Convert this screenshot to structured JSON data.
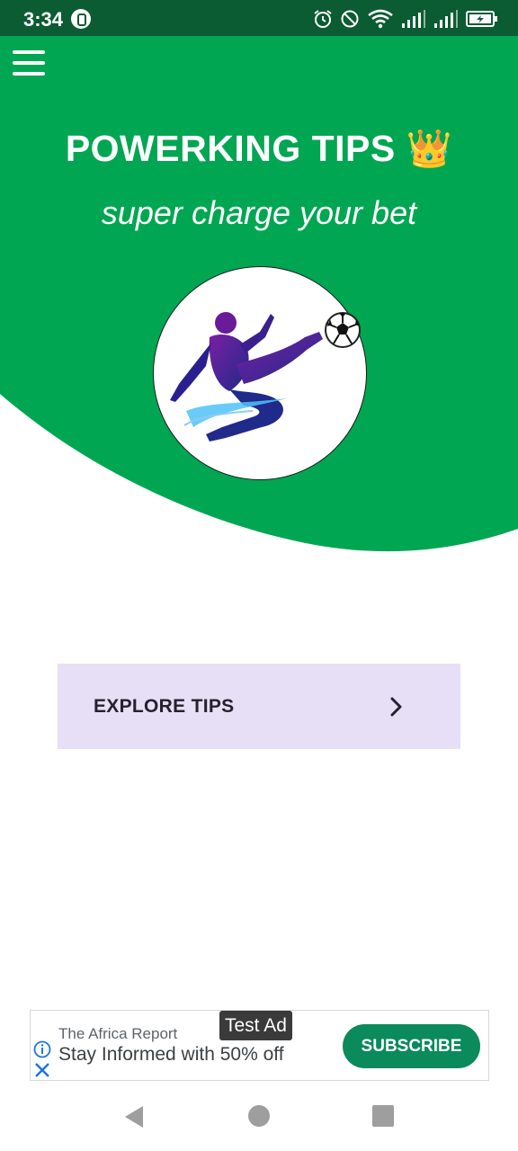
{
  "status_bar": {
    "time": "3:34",
    "icons": [
      "app-notification-icon",
      "alarm-icon",
      "do-not-disturb-icon",
      "wifi-icon",
      "signal-icon",
      "signal-icon",
      "battery-charging-icon"
    ]
  },
  "header": {
    "title": "POWERKING TIPS 👑",
    "subtitle": "super charge your bet",
    "brand_color": "#00a651",
    "menu_icon": "hamburger-menu-icon",
    "logo": "footballer-kick-logo"
  },
  "main": {
    "explore_button": {
      "label": "EXPLORE TIPS",
      "icon": "chevron-right-icon",
      "background": "#e6dff6"
    }
  },
  "ad": {
    "badge": "Test Ad",
    "advertiser": "The Africa Report",
    "headline": "Stay Informed with 50% off",
    "cta_label": "SUBSCRIBE",
    "cta_color": "#0b8a5c",
    "icons": [
      "info-icon",
      "close-icon"
    ]
  },
  "nav_bar": {
    "icons": [
      "back-icon",
      "home-icon",
      "recents-icon"
    ]
  }
}
